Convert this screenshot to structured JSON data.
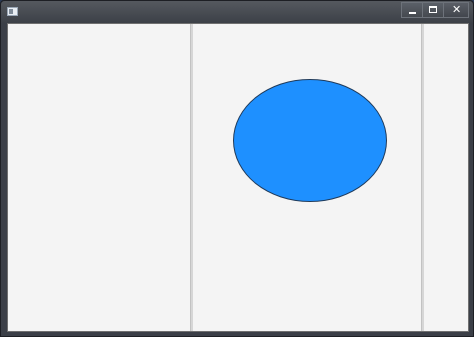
{
  "window": {
    "title": "",
    "icon": "app-window-icon",
    "controls": {
      "minimize_icon": "minimize-icon",
      "maximize_icon": "maximize-icon",
      "close_icon": "close-icon",
      "close_glyph": "✕"
    }
  },
  "canvas": {
    "background_color": "#f4f4f4",
    "divider_color": "#d6d6d6",
    "shape": {
      "type": "ellipse",
      "fill_color": "#1e90ff",
      "stroke_color": "#1f3a5a"
    }
  }
}
